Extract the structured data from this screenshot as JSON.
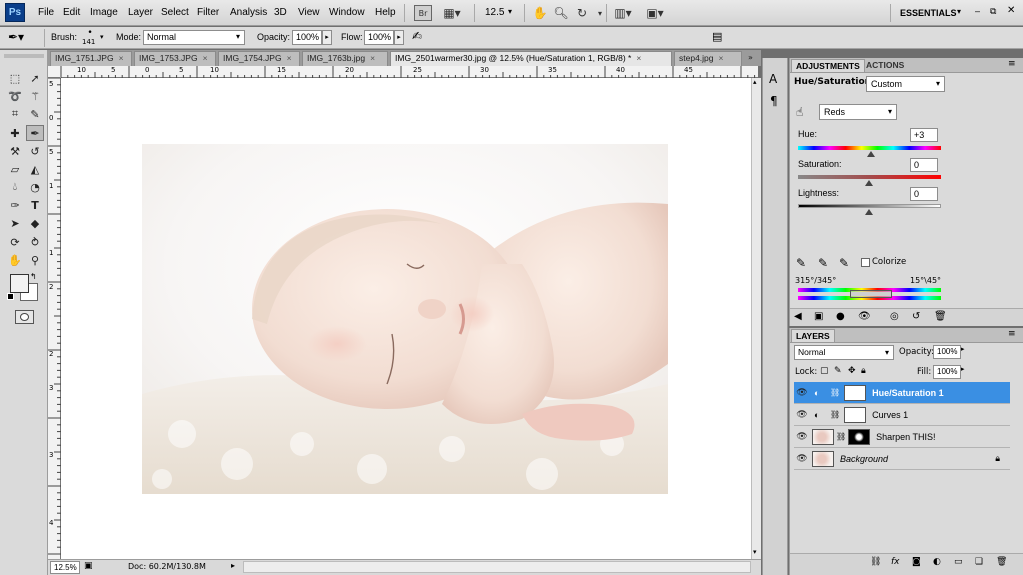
{
  "app": {
    "logo": "Ps",
    "workspace": "ESSENTIALS",
    "zoom_field": "12.5"
  },
  "menu": [
    "File",
    "Edit",
    "Image",
    "Layer",
    "Select",
    "Filter",
    "Analysis",
    "3D",
    "View",
    "Window",
    "Help"
  ],
  "options": {
    "brush_label": "Brush:",
    "brush_size": "141",
    "mode_label": "Mode:",
    "mode_value": "Normal",
    "opacity_label": "Opacity:",
    "opacity_value": "100%",
    "flow_label": "Flow:",
    "flow_value": "100%"
  },
  "tabs": [
    {
      "label": "IMG_1751.JPG"
    },
    {
      "label": "IMG_1753.JPG"
    },
    {
      "label": "IMG_1754.JPG"
    },
    {
      "label": "IMG_1763b.jpg"
    },
    {
      "label": "IMG_2501warmer30.jpg @ 12.5% (Hue/Saturation 1, RGB/8) *"
    },
    {
      "label": "step4.jpg"
    }
  ],
  "ruler": {
    "h_ticks": [
      "10",
      "5",
      "0",
      "5",
      "10",
      "15",
      "20",
      "25",
      "30",
      "35",
      "40",
      "45"
    ],
    "v_ticks": [
      "5",
      "0",
      "5",
      "1",
      "1",
      "2",
      "2",
      "3",
      "3",
      "4"
    ]
  },
  "status": {
    "zoom": "12.5%",
    "doc": "Doc: 60.2M/130.8M"
  },
  "adjustments": {
    "tab_active": "ADJUSTMENTS",
    "tab_other": "ACTIONS",
    "title": "Hue/Saturation",
    "preset": "Custom",
    "channel": "Reds",
    "hue_label": "Hue:",
    "hue_value": "+3",
    "sat_label": "Saturation:",
    "sat_value": "0",
    "light_label": "Lightness:",
    "light_value": "0",
    "colorize_label": "Colorize",
    "range_left": "315°/345°",
    "range_right": "15°\\45°"
  },
  "layers": {
    "tab": "LAYERS",
    "blend": "Normal",
    "opacity_label": "Opacity:",
    "opacity_value": "100%",
    "lock_label": "Lock:",
    "fill_label": "Fill:",
    "fill_value": "100%",
    "items": [
      {
        "name": "Hue/Saturation 1"
      },
      {
        "name": "Curves 1"
      },
      {
        "name": "Sharpen THIS!"
      },
      {
        "name": "Background"
      }
    ]
  },
  "colors": {
    "accent": "#3a8fe3",
    "app_bg": "#6f6f6f",
    "panel_bg": "#dadada"
  }
}
